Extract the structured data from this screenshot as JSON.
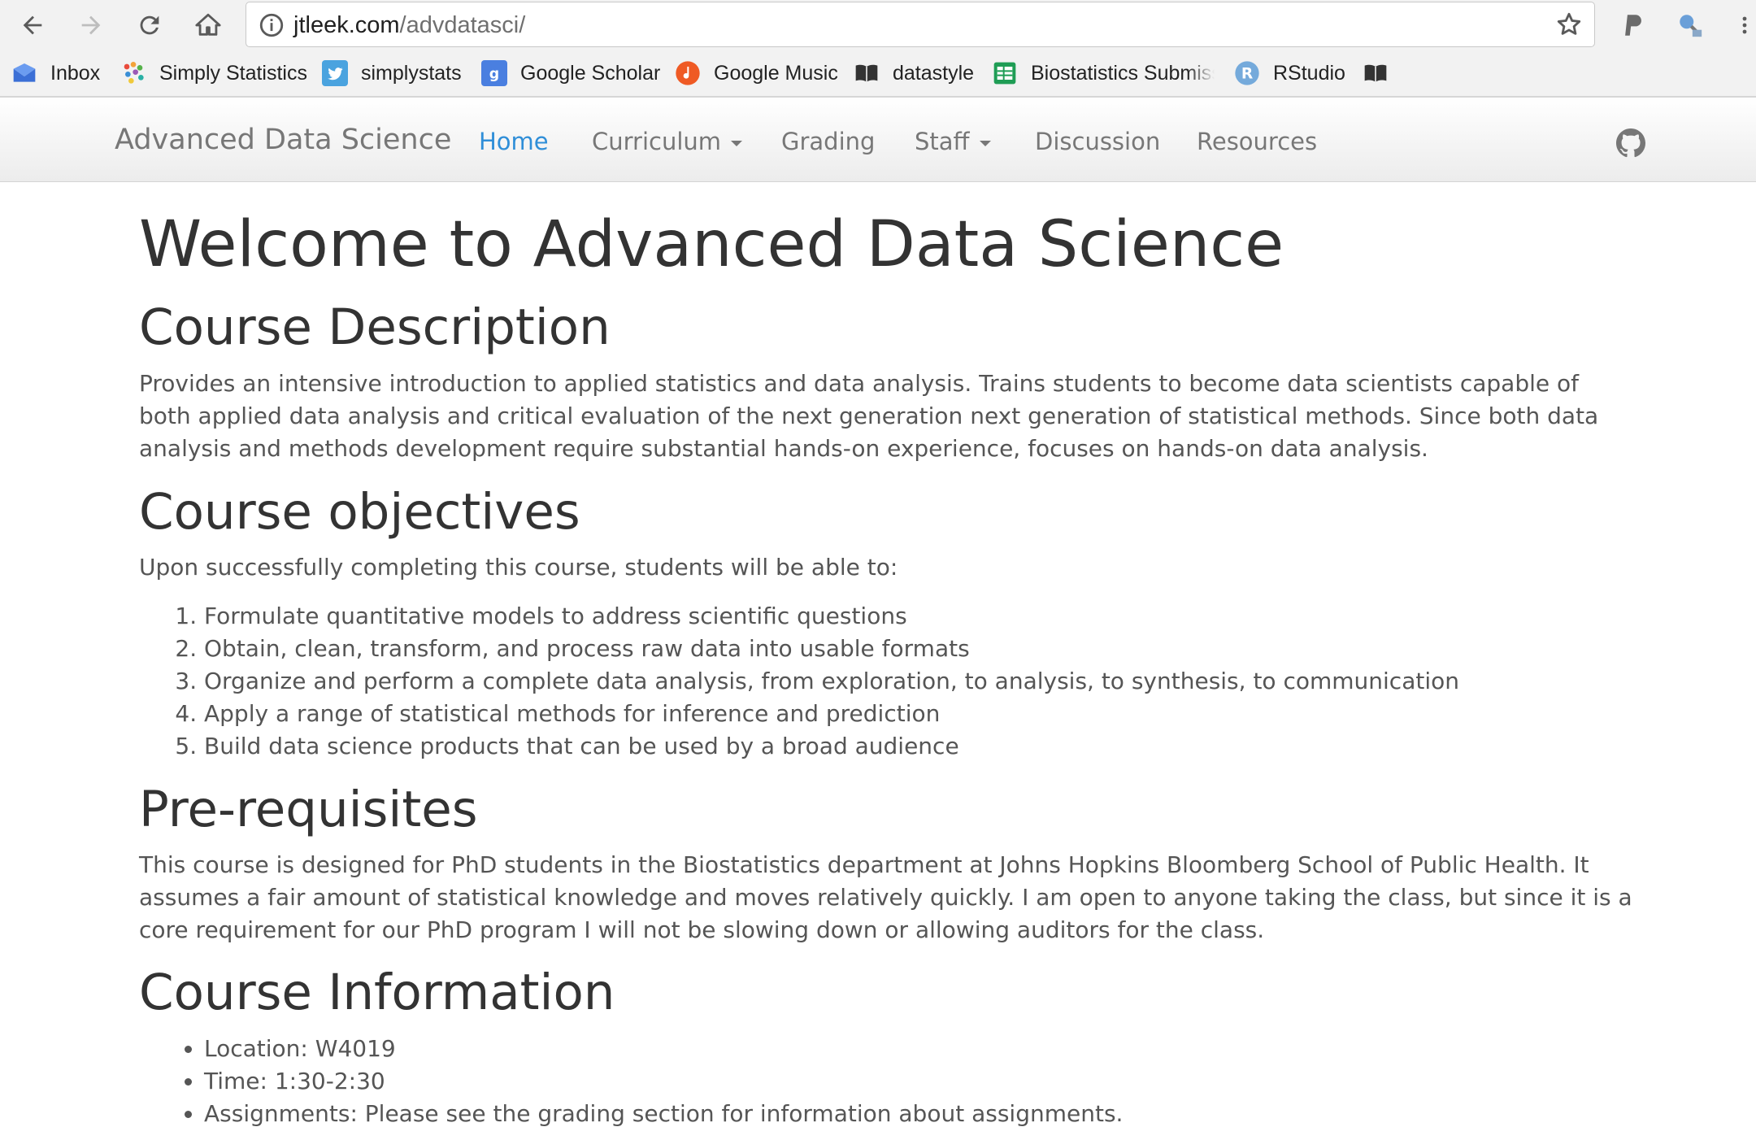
{
  "browser": {
    "url_domain": "jtleek.com",
    "url_path": "/advdatasci/",
    "bookmarks": [
      {
        "label": "Inbox",
        "icon": "inbox-icon"
      },
      {
        "label": "Simply Statistics",
        "icon": "simply-statistics-icon"
      },
      {
        "label": "simplystats",
        "icon": "twitter-icon"
      },
      {
        "label": "Google Scholar",
        "icon": "google-scholar-icon"
      },
      {
        "label": "Google Music",
        "icon": "google-music-icon"
      },
      {
        "label": "datastyle",
        "icon": "book-icon"
      },
      {
        "label": "Biostatistics Submiss",
        "icon": "sheets-icon"
      },
      {
        "label": "RStudio",
        "icon": "rstudio-icon"
      },
      {
        "label": "",
        "icon": "book-icon"
      }
    ]
  },
  "navbar": {
    "brand": "Advanced Data Science",
    "links": [
      {
        "label": "Home",
        "active": true
      },
      {
        "label": "Curriculum",
        "dropdown": true
      },
      {
        "label": "Grading"
      },
      {
        "label": "Staff",
        "dropdown": true
      },
      {
        "label": "Discussion"
      },
      {
        "label": "Resources"
      }
    ]
  },
  "content": {
    "title": "Welcome to Advanced Data Science",
    "description": {
      "heading": "Course Description",
      "text": "Provides an intensive introduction to applied statistics and data analysis. Trains students to become data scientists capable of both applied data analysis and critical evaluation of the next generation next generation of statistical methods. Since both data analysis and methods development require substantial hands-on experience, focuses on hands-on data analysis."
    },
    "objectives": {
      "heading": "Course objectives",
      "intro": "Upon successfully completing this course, students will be able to:",
      "items": [
        "Formulate quantitative models to address scientific questions",
        "Obtain, clean, transform, and process raw data into usable formats",
        "Organize and perform a complete data analysis, from exploration, to analysis, to synthesis, to communication",
        "Apply a range of statistical methods for inference and prediction",
        "Build data science products that can be used by a broad audience"
      ]
    },
    "prerequisites": {
      "heading": "Pre-requisites",
      "text": "This course is designed for PhD students in the Biostatistics department at Johns Hopkins Bloomberg School of Public Health. It assumes a fair amount of statistical knowledge and moves relatively quickly. I am open to anyone taking the class, but since it is a core requirement for our PhD program I will not be slowing down or allowing auditors for the class."
    },
    "info": {
      "heading": "Course Information",
      "items": [
        "Location: W4019",
        "Time: 1:30-2:30",
        "Assignments: Please see the grading section for information about assignments."
      ]
    }
  },
  "colors": {
    "link_active": "#2f8ed8",
    "nav_text": "#777777",
    "body_text": "#555555",
    "heading_text": "#333333"
  }
}
